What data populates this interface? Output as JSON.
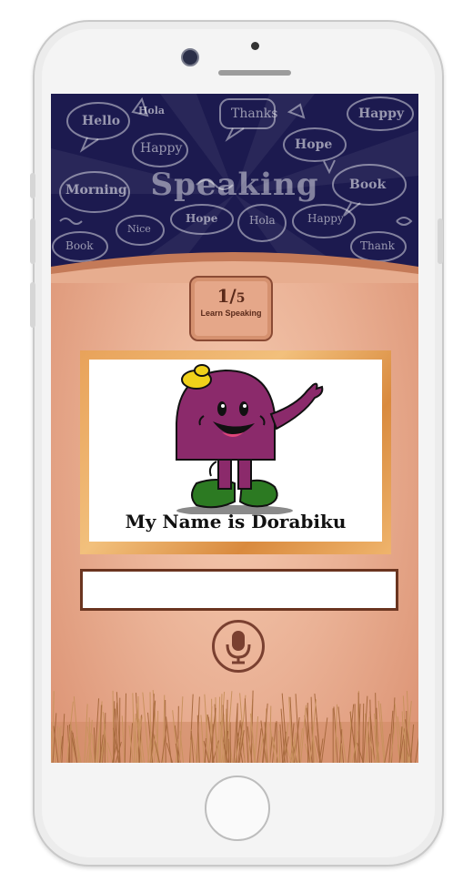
{
  "header": {
    "title": "Speaking",
    "bubble_words": [
      "Hello",
      "Hola",
      "Thanks",
      "Happy",
      "Happy",
      "Hope",
      "Morning",
      "Book",
      "Hope",
      "Hola",
      "Happy",
      "Nice",
      "Book",
      "Thank"
    ]
  },
  "progress": {
    "current": "1",
    "total": "5",
    "label": "Learn Speaking"
  },
  "lesson": {
    "caption": "My Name is Dorabiku"
  },
  "answer": {
    "value": ""
  },
  "icons": {
    "mic": "microphone-icon"
  },
  "colors": {
    "header_bg": "#1c1a4f",
    "character": "#8b2a6b",
    "hat": "#f0d11a",
    "shoes": "#2c7a22",
    "accent": "#7a4030"
  }
}
